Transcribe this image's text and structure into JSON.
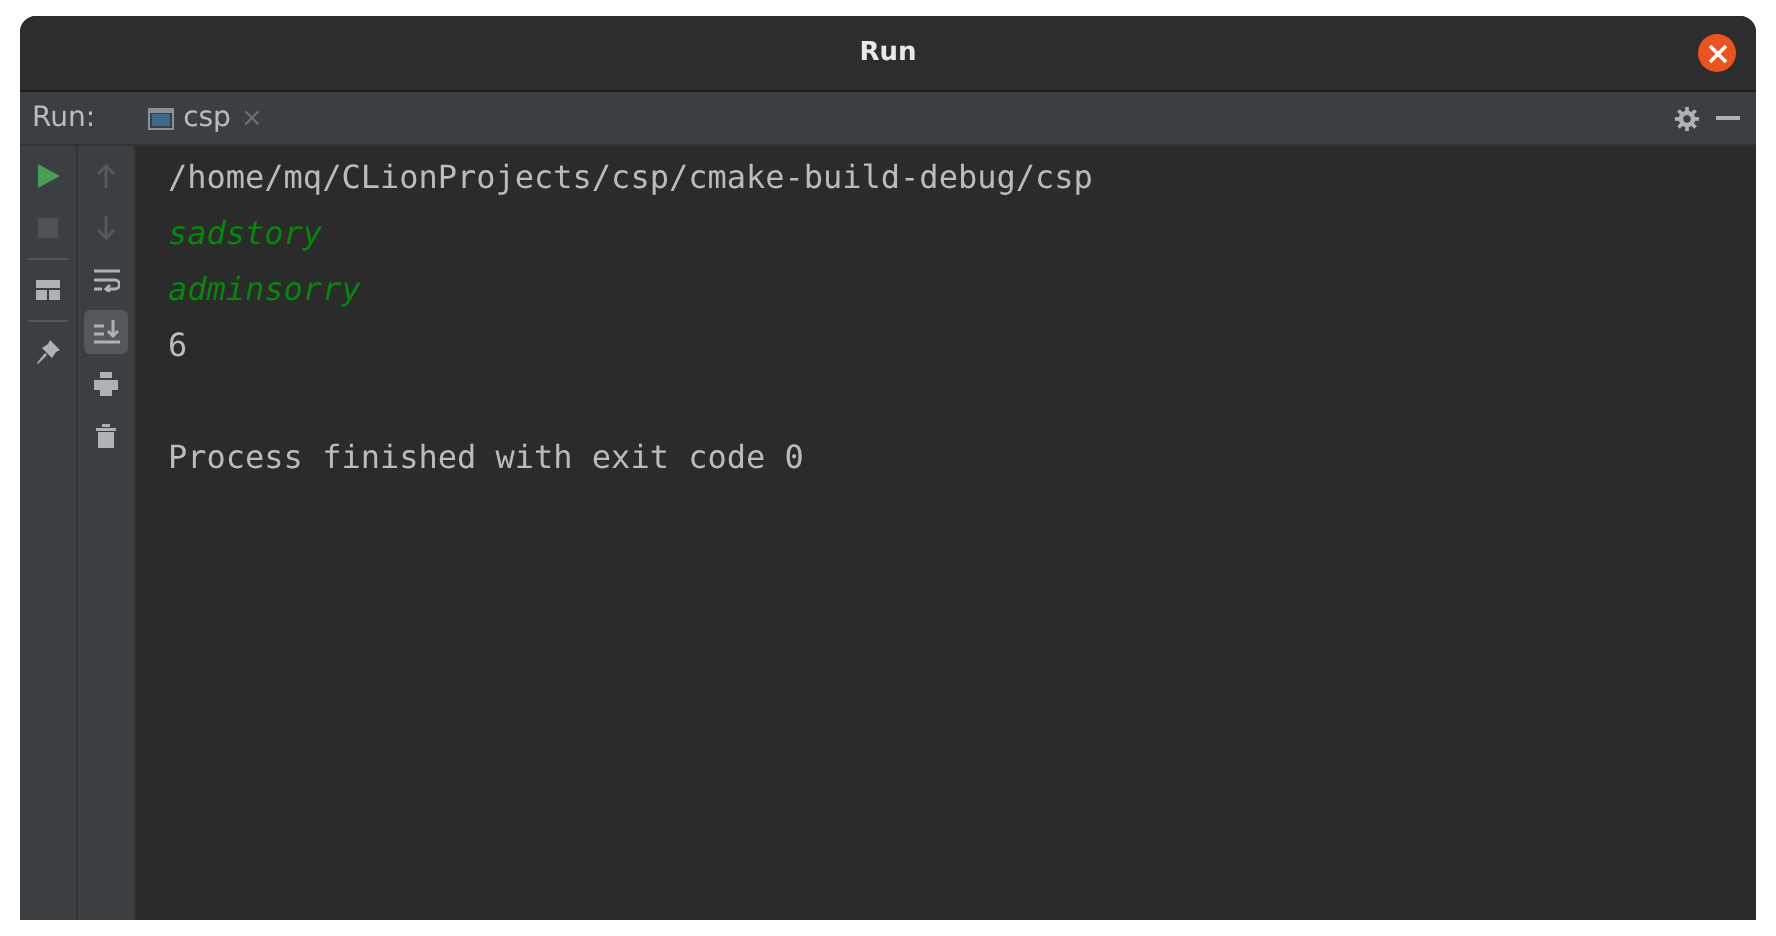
{
  "window": {
    "title": "Run"
  },
  "toolbar": {
    "label": "Run:",
    "tab": {
      "label": "csp",
      "close": "×"
    }
  },
  "run_controls": [
    {
      "kind": "run",
      "disabled": false
    },
    {
      "kind": "stop",
      "disabled": true
    },
    {
      "kind": "layout",
      "disabled": false
    },
    {
      "kind": "pin",
      "disabled": false
    }
  ],
  "console_controls": [
    {
      "kind": "up",
      "disabled": true,
      "selected": false
    },
    {
      "kind": "down",
      "disabled": true,
      "selected": false
    },
    {
      "kind": "wrap",
      "disabled": false,
      "selected": false
    },
    {
      "kind": "scroll-end",
      "disabled": false,
      "selected": true
    },
    {
      "kind": "print",
      "disabled": false,
      "selected": false
    },
    {
      "kind": "trash",
      "disabled": false,
      "selected": false
    }
  ],
  "console": [
    {
      "kind": "command",
      "text": "/home/mq/CLionProjects/csp/cmake-build-debug/csp"
    },
    {
      "kind": "input",
      "text": "sadstory"
    },
    {
      "kind": "input",
      "text": "adminsorry"
    },
    {
      "kind": "output",
      "text": "6"
    },
    {
      "kind": "exit",
      "text": "Process finished with exit code 0"
    }
  ]
}
